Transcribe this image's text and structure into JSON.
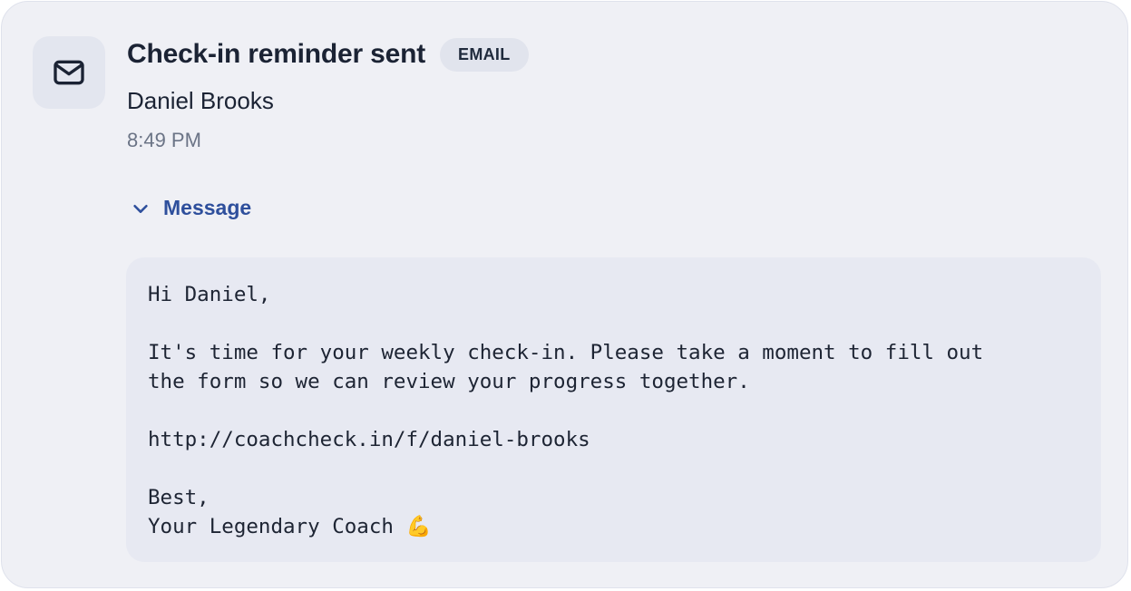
{
  "event": {
    "icon": "mail-icon",
    "title": "Check-in reminder sent",
    "channel_badge": "EMAIL",
    "recipient": "Daniel Brooks",
    "time": "8:49 PM"
  },
  "message_section": {
    "toggle_icon": "chevron-down-icon",
    "toggle_label": "Message",
    "expanded": true,
    "body": "Hi Daniel,\n\nIt's time for your weekly check-in. Please take a moment to fill out\nthe form so we can review your progress together.\n\nhttp://coachcheck.in/f/daniel-brooks\n\nBest,\nYour Legendary Coach 💪"
  },
  "colors": {
    "card_background": "#eff0f5",
    "accent": "#2e4f9c",
    "text_primary": "#1b2334",
    "text_muted": "#6b7486"
  }
}
